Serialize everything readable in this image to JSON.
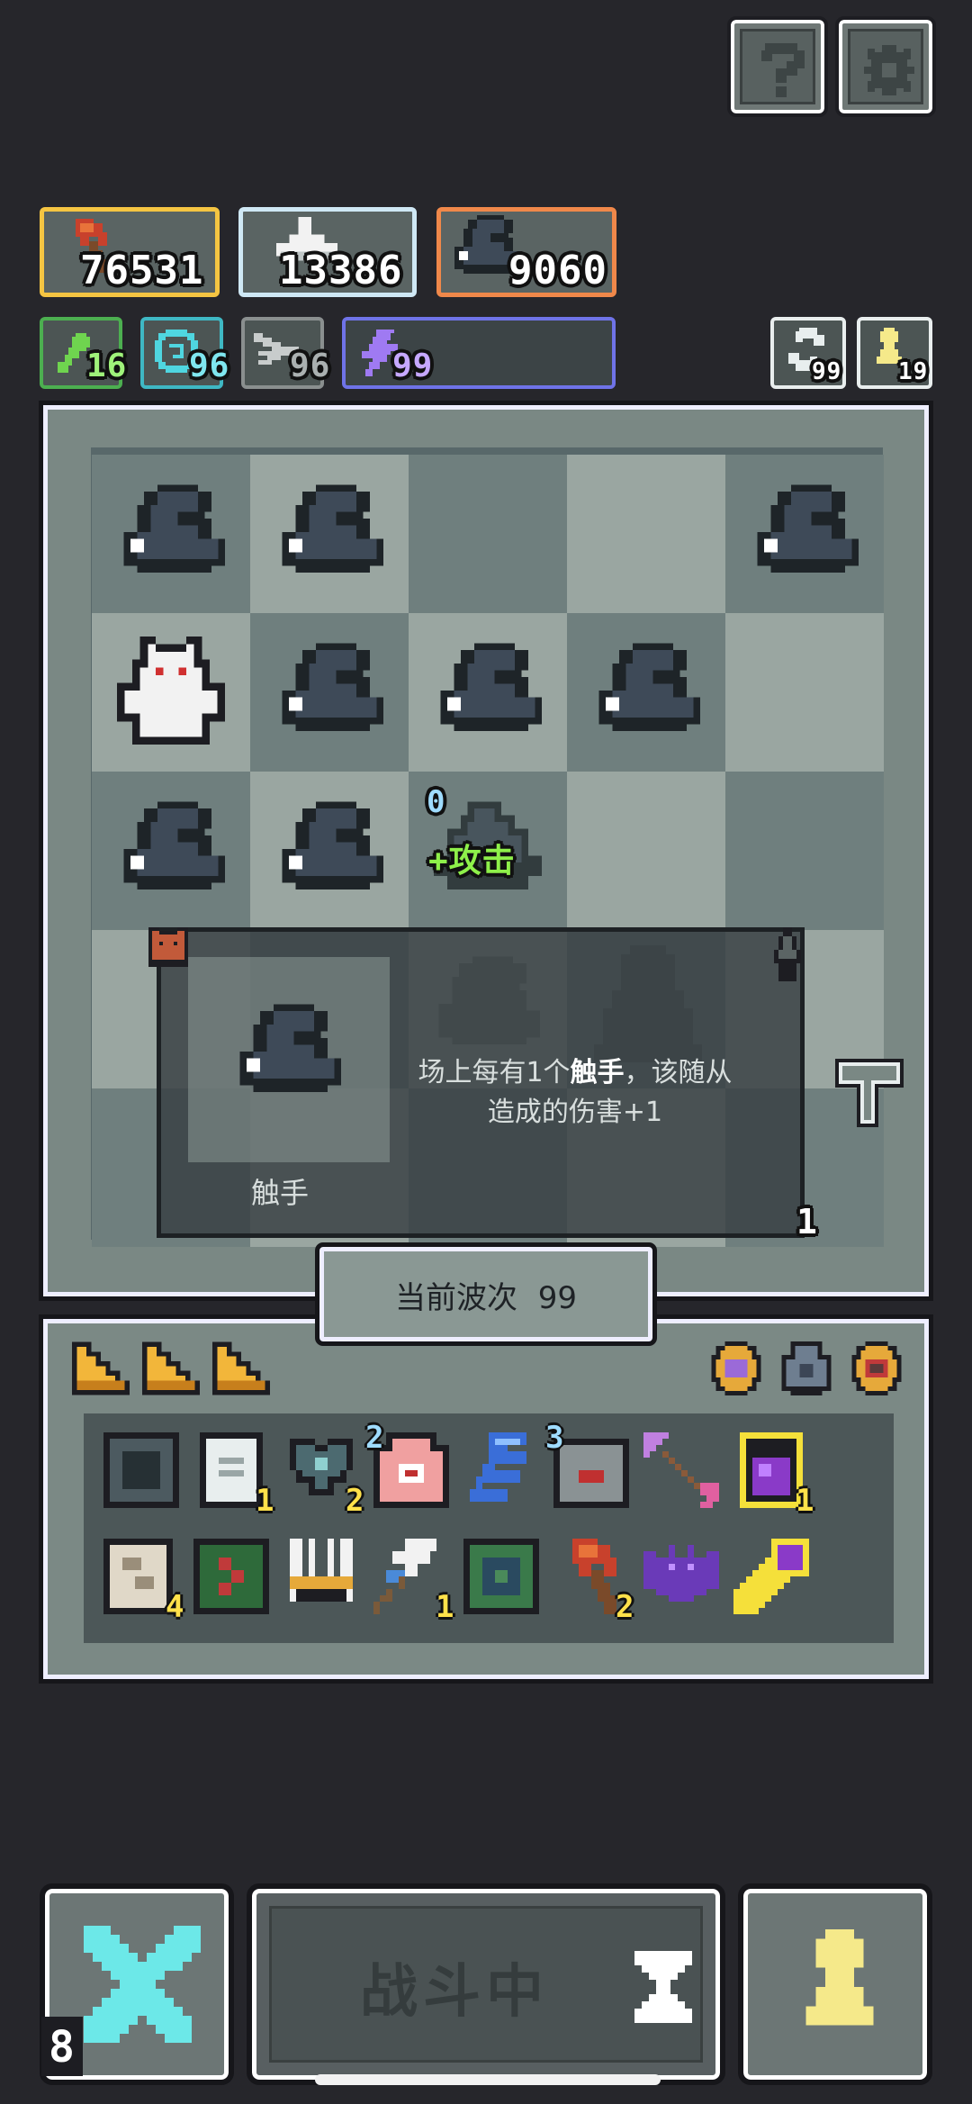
{
  "top_buttons": {
    "help_icon": "question-icon",
    "settings_icon": "gear-icon"
  },
  "resources": [
    {
      "value": "76531",
      "icon": "axe-icon",
      "color": "#f5c542"
    },
    {
      "value": "13386",
      "icon": "hand-icon",
      "color": "#cfe8f5"
    },
    {
      "value": "9060",
      "icon": "tentacle-icon",
      "color": "#f0884a"
    }
  ],
  "stats": [
    {
      "value": "16",
      "icon": "poison-icon",
      "color": "#4caf50"
    },
    {
      "value": "96",
      "icon": "spiral-icon",
      "color": "#3fb8c4"
    },
    {
      "value": "96",
      "icon": "wing-icon",
      "color": "#8a8f8f"
    },
    {
      "value": "99",
      "icon": "lightning-icon",
      "color": "#6f73e8"
    }
  ],
  "counters": [
    {
      "value": "99",
      "icon": "refresh-icon"
    },
    {
      "value": "19",
      "icon": "pawn-icon"
    }
  ],
  "board_popup": {
    "attack_badge_count": "0",
    "attack_badge_text": "+攻击",
    "unit_name": "触手",
    "desc_prefix": "场上每有1个",
    "desc_keyword": "触手",
    "desc_suffix": "，该随从",
    "desc_line2": "造成的伤害+1",
    "corner_count": "1"
  },
  "wave": {
    "label": "当前波次",
    "number": "99"
  },
  "bag": {
    "items": [
      {
        "icon": "iron-block-icon",
        "count": ""
      },
      {
        "icon": "scroll-icon",
        "count": "1"
      },
      {
        "icon": "heart-gem-icon",
        "count": "2"
      },
      {
        "icon": "eye-palm-icon",
        "count": "2",
        "count_pos": "tl"
      },
      {
        "icon": "blue-wave-icon",
        "count": ""
      },
      {
        "icon": "stone-block-icon",
        "count": "3",
        "count_pos": "tl"
      },
      {
        "icon": "arrow-icon",
        "count": ""
      },
      {
        "icon": "potion-icon",
        "count": "1"
      },
      {
        "icon": "map-scroll-icon",
        "count": "4"
      },
      {
        "icon": "vine-tile-icon",
        "count": ""
      },
      {
        "icon": "crown-claws-icon",
        "count": ""
      },
      {
        "icon": "bird-staff-icon",
        "count": "1"
      },
      {
        "icon": "green-tile-icon",
        "count": ""
      },
      {
        "icon": "axe-icon",
        "count": "2"
      },
      {
        "icon": "bat-icon",
        "count": ""
      },
      {
        "icon": "scepter-icon",
        "count": ""
      }
    ]
  },
  "bottom": {
    "battle_label": "战斗中",
    "left_badge": "8",
    "left_icon": "crossed-swords-icon",
    "right_icon": "pawn-icon",
    "hourglass_icon": "hourglass-icon"
  }
}
